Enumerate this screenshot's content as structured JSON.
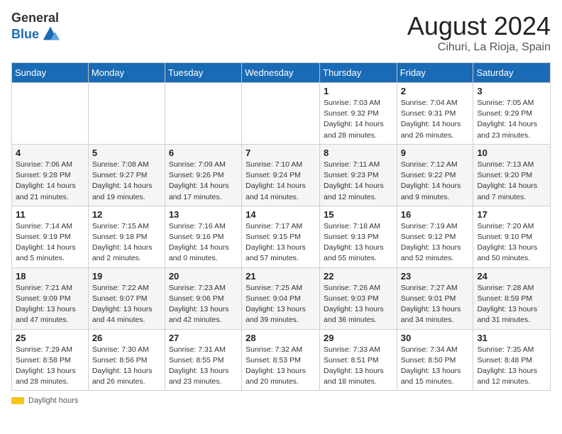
{
  "logo": {
    "general": "General",
    "blue": "Blue"
  },
  "title": "August 2024",
  "location": "Cihuri, La Rioja, Spain",
  "weekdays": [
    "Sunday",
    "Monday",
    "Tuesday",
    "Wednesday",
    "Thursday",
    "Friday",
    "Saturday"
  ],
  "footer": {
    "daylight_label": "Daylight hours"
  },
  "weeks": [
    [
      {
        "day": "",
        "info": ""
      },
      {
        "day": "",
        "info": ""
      },
      {
        "day": "",
        "info": ""
      },
      {
        "day": "",
        "info": ""
      },
      {
        "day": "1",
        "info": "Sunrise: 7:03 AM\nSunset: 9:32 PM\nDaylight: 14 hours\nand 28 minutes."
      },
      {
        "day": "2",
        "info": "Sunrise: 7:04 AM\nSunset: 9:31 PM\nDaylight: 14 hours\nand 26 minutes."
      },
      {
        "day": "3",
        "info": "Sunrise: 7:05 AM\nSunset: 9:29 PM\nDaylight: 14 hours\nand 23 minutes."
      }
    ],
    [
      {
        "day": "4",
        "info": "Sunrise: 7:06 AM\nSunset: 9:28 PM\nDaylight: 14 hours\nand 21 minutes."
      },
      {
        "day": "5",
        "info": "Sunrise: 7:08 AM\nSunset: 9:27 PM\nDaylight: 14 hours\nand 19 minutes."
      },
      {
        "day": "6",
        "info": "Sunrise: 7:09 AM\nSunset: 9:26 PM\nDaylight: 14 hours\nand 17 minutes."
      },
      {
        "day": "7",
        "info": "Sunrise: 7:10 AM\nSunset: 9:24 PM\nDaylight: 14 hours\nand 14 minutes."
      },
      {
        "day": "8",
        "info": "Sunrise: 7:11 AM\nSunset: 9:23 PM\nDaylight: 14 hours\nand 12 minutes."
      },
      {
        "day": "9",
        "info": "Sunrise: 7:12 AM\nSunset: 9:22 PM\nDaylight: 14 hours\nand 9 minutes."
      },
      {
        "day": "10",
        "info": "Sunrise: 7:13 AM\nSunset: 9:20 PM\nDaylight: 14 hours\nand 7 minutes."
      }
    ],
    [
      {
        "day": "11",
        "info": "Sunrise: 7:14 AM\nSunset: 9:19 PM\nDaylight: 14 hours\nand 5 minutes."
      },
      {
        "day": "12",
        "info": "Sunrise: 7:15 AM\nSunset: 9:18 PM\nDaylight: 14 hours\nand 2 minutes."
      },
      {
        "day": "13",
        "info": "Sunrise: 7:16 AM\nSunset: 9:16 PM\nDaylight: 14 hours\nand 0 minutes."
      },
      {
        "day": "14",
        "info": "Sunrise: 7:17 AM\nSunset: 9:15 PM\nDaylight: 13 hours\nand 57 minutes."
      },
      {
        "day": "15",
        "info": "Sunrise: 7:18 AM\nSunset: 9:13 PM\nDaylight: 13 hours\nand 55 minutes."
      },
      {
        "day": "16",
        "info": "Sunrise: 7:19 AM\nSunset: 9:12 PM\nDaylight: 13 hours\nand 52 minutes."
      },
      {
        "day": "17",
        "info": "Sunrise: 7:20 AM\nSunset: 9:10 PM\nDaylight: 13 hours\nand 50 minutes."
      }
    ],
    [
      {
        "day": "18",
        "info": "Sunrise: 7:21 AM\nSunset: 9:09 PM\nDaylight: 13 hours\nand 47 minutes."
      },
      {
        "day": "19",
        "info": "Sunrise: 7:22 AM\nSunset: 9:07 PM\nDaylight: 13 hours\nand 44 minutes."
      },
      {
        "day": "20",
        "info": "Sunrise: 7:23 AM\nSunset: 9:06 PM\nDaylight: 13 hours\nand 42 minutes."
      },
      {
        "day": "21",
        "info": "Sunrise: 7:25 AM\nSunset: 9:04 PM\nDaylight: 13 hours\nand 39 minutes."
      },
      {
        "day": "22",
        "info": "Sunrise: 7:26 AM\nSunset: 9:03 PM\nDaylight: 13 hours\nand 36 minutes."
      },
      {
        "day": "23",
        "info": "Sunrise: 7:27 AM\nSunset: 9:01 PM\nDaylight: 13 hours\nand 34 minutes."
      },
      {
        "day": "24",
        "info": "Sunrise: 7:28 AM\nSunset: 8:59 PM\nDaylight: 13 hours\nand 31 minutes."
      }
    ],
    [
      {
        "day": "25",
        "info": "Sunrise: 7:29 AM\nSunset: 8:58 PM\nDaylight: 13 hours\nand 28 minutes."
      },
      {
        "day": "26",
        "info": "Sunrise: 7:30 AM\nSunset: 8:56 PM\nDaylight: 13 hours\nand 26 minutes."
      },
      {
        "day": "27",
        "info": "Sunrise: 7:31 AM\nSunset: 8:55 PM\nDaylight: 13 hours\nand 23 minutes."
      },
      {
        "day": "28",
        "info": "Sunrise: 7:32 AM\nSunset: 8:53 PM\nDaylight: 13 hours\nand 20 minutes."
      },
      {
        "day": "29",
        "info": "Sunrise: 7:33 AM\nSunset: 8:51 PM\nDaylight: 13 hours\nand 18 minutes."
      },
      {
        "day": "30",
        "info": "Sunrise: 7:34 AM\nSunset: 8:50 PM\nDaylight: 13 hours\nand 15 minutes."
      },
      {
        "day": "31",
        "info": "Sunrise: 7:35 AM\nSunset: 8:48 PM\nDaylight: 13 hours\nand 12 minutes."
      }
    ]
  ]
}
